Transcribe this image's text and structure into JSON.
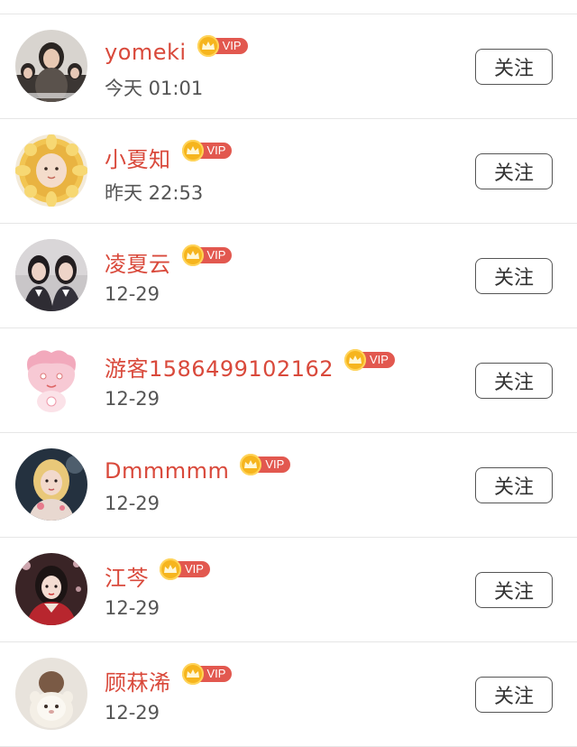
{
  "follow_label": "关注",
  "vip_label": "VIP",
  "colors": {
    "name": "#d9493b",
    "vip_tag": "#e2584f",
    "crown": "#f6b51e",
    "divider": "#e6e6e6"
  },
  "users": [
    {
      "name": "yomeki",
      "time": "今天 01:01",
      "avatar": "avatar-group-photo"
    },
    {
      "name": "小夏知",
      "time": "昨天 22:53",
      "avatar": "avatar-sunflower-costume"
    },
    {
      "name": "凌夏云",
      "time": "12-29",
      "avatar": "avatar-two-girls"
    },
    {
      "name": "游客1586499102162",
      "time": "12-29",
      "avatar": "avatar-cartoon-pink"
    },
    {
      "name": "Dmmmmm",
      "time": "12-29",
      "avatar": "avatar-blonde-girl"
    },
    {
      "name": "江芩",
      "time": "12-29",
      "avatar": "avatar-red-costume"
    },
    {
      "name": "顾菻浠",
      "time": "12-29",
      "avatar": "avatar-plush-toy"
    }
  ]
}
